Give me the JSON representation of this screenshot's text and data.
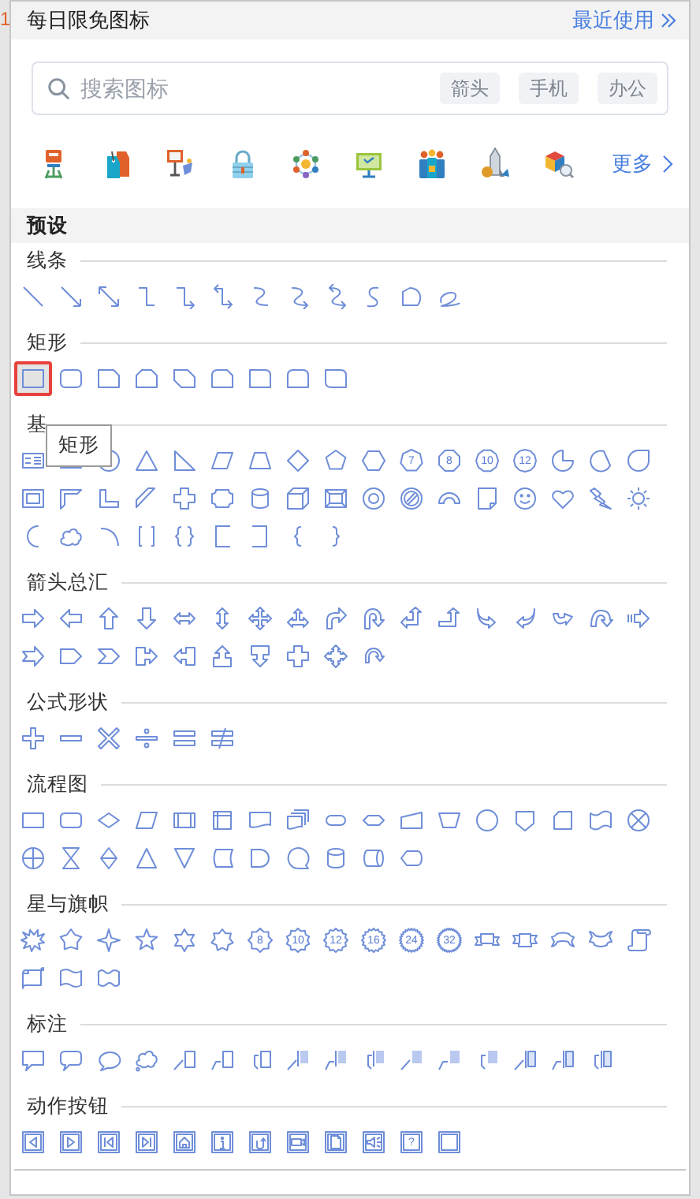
{
  "background": {
    "fragment": "1"
  },
  "free_icons": {
    "title": "每日限免图标",
    "recent_link": "最近使用",
    "search": {
      "placeholder": "搜索图标"
    },
    "tags": [
      "箭头",
      "手机",
      "办公"
    ],
    "more_link": "更多"
  },
  "presets": {
    "title": "预设",
    "tooltip": "矩形",
    "groups": [
      {
        "title": "线条",
        "shapes": [
          {
            "kind": "line",
            "selected": false
          },
          {
            "kind": "arrow",
            "selected": false
          },
          {
            "kind": "double-arrow",
            "selected": false
          },
          {
            "kind": "elbow",
            "selected": false
          },
          {
            "kind": "elbow-arrow",
            "selected": false
          },
          {
            "kind": "elbow-double-arrow",
            "selected": false
          },
          {
            "kind": "curve",
            "selected": false
          },
          {
            "kind": "curve-arrow",
            "selected": false
          },
          {
            "kind": "curve-double-arrow",
            "selected": false
          },
          {
            "kind": "freeform-s",
            "selected": false
          },
          {
            "kind": "freeform",
            "selected": false
          },
          {
            "kind": "scribble",
            "selected": false
          }
        ]
      },
      {
        "title": "矩形",
        "shapes": [
          {
            "kind": "rect",
            "selected": true
          },
          {
            "kind": "round-rect",
            "selected": false
          },
          {
            "kind": "snip1",
            "selected": false
          },
          {
            "kind": "snip2-same",
            "selected": false
          },
          {
            "kind": "snip2-diag",
            "selected": false
          },
          {
            "kind": "snip-round",
            "selected": false
          },
          {
            "kind": "round1",
            "selected": false
          },
          {
            "kind": "round2-same",
            "selected": false
          },
          {
            "kind": "round2-diag",
            "selected": false
          }
        ]
      },
      {
        "title": "基",
        "shapes": [
          {
            "kind": "textbox",
            "selected": false
          },
          {
            "kind": "textbox-v",
            "selected": false
          },
          {
            "kind": "ellipse",
            "selected": false
          },
          {
            "kind": "triangle",
            "selected": false
          },
          {
            "kind": "right-triangle",
            "selected": false
          },
          {
            "kind": "parallelogram",
            "selected": false
          },
          {
            "kind": "trapezoid",
            "selected": false
          },
          {
            "kind": "diamond",
            "selected": false
          },
          {
            "kind": "pentagon",
            "selected": false
          },
          {
            "kind": "hexagon",
            "selected": false
          },
          {
            "kind": "heptagon",
            "label": "7",
            "selected": false
          },
          {
            "kind": "octagon",
            "label": "8",
            "selected": false
          },
          {
            "kind": "decagon",
            "label": "10",
            "selected": false
          },
          {
            "kind": "dodecagon",
            "label": "12",
            "selected": false
          },
          {
            "kind": "pie",
            "selected": false
          },
          {
            "kind": "chord",
            "selected": false
          },
          {
            "kind": "teardrop",
            "selected": false
          },
          {
            "kind": "frame",
            "selected": false
          },
          {
            "kind": "half-frame",
            "selected": false
          },
          {
            "kind": "l-shape",
            "selected": false
          },
          {
            "kind": "diag-stripe",
            "selected": false
          },
          {
            "kind": "cross",
            "selected": false
          },
          {
            "kind": "plaque",
            "selected": false
          },
          {
            "kind": "can",
            "selected": false
          },
          {
            "kind": "cube",
            "selected": false
          },
          {
            "kind": "bevel",
            "selected": false
          },
          {
            "kind": "donut",
            "selected": false
          },
          {
            "kind": "no-symbol",
            "selected": false
          },
          {
            "kind": "block-arc",
            "selected": false
          },
          {
            "kind": "folded-corner",
            "selected": false
          },
          {
            "kind": "smiley",
            "selected": false
          },
          {
            "kind": "heart",
            "selected": false
          },
          {
            "kind": "lightning",
            "selected": false
          },
          {
            "kind": "sun",
            "selected": false
          },
          {
            "kind": "moon",
            "selected": false
          },
          {
            "kind": "cloud",
            "selected": false
          },
          {
            "kind": "arc",
            "selected": false
          },
          {
            "kind": "double-bracket",
            "selected": false
          },
          {
            "kind": "double-brace",
            "selected": false
          },
          {
            "kind": "left-bracket",
            "selected": false
          },
          {
            "kind": "right-bracket",
            "selected": false
          },
          {
            "kind": "left-brace",
            "selected": false
          },
          {
            "kind": "right-brace",
            "selected": false
          }
        ]
      },
      {
        "title": "箭头总汇",
        "shapes": [
          {
            "kind": "right-arrow",
            "selected": false
          },
          {
            "kind": "left-arrow",
            "selected": false
          },
          {
            "kind": "up-arrow",
            "selected": false
          },
          {
            "kind": "down-arrow",
            "selected": false
          },
          {
            "kind": "left-right-arrow",
            "selected": false
          },
          {
            "kind": "up-down-arrow",
            "selected": false
          },
          {
            "kind": "quad-arrow",
            "selected": false
          },
          {
            "kind": "left-right-up-arrow",
            "selected": false
          },
          {
            "kind": "bent-arrow",
            "selected": false
          },
          {
            "kind": "u-turn-arrow",
            "selected": false
          },
          {
            "kind": "left-up-arrow",
            "selected": false
          },
          {
            "kind": "bent-up-arrow",
            "selected": false
          },
          {
            "kind": "curved-right-arrow",
            "selected": false
          },
          {
            "kind": "curved-left-arrow",
            "selected": false
          },
          {
            "kind": "curved-up-arrow",
            "selected": false
          },
          {
            "kind": "curved-down-arrow",
            "selected": false
          },
          {
            "kind": "striped-right-arrow",
            "selected": false
          },
          {
            "kind": "notched-right-arrow",
            "selected": false
          },
          {
            "kind": "pentagon-arrow",
            "selected": false
          },
          {
            "kind": "chevron",
            "selected": false
          },
          {
            "kind": "right-callout-arrow",
            "selected": false
          },
          {
            "kind": "left-callout-arrow",
            "selected": false
          },
          {
            "kind": "up-callout-arrow",
            "selected": false
          },
          {
            "kind": "down-callout-arrow",
            "selected": false
          },
          {
            "kind": "plus-callout-arrow",
            "selected": false
          },
          {
            "kind": "quad-callout-arrow",
            "selected": false
          },
          {
            "kind": "circular-arrow",
            "selected": false
          }
        ]
      },
      {
        "title": "公式形状",
        "shapes": [
          {
            "kind": "plus",
            "selected": false
          },
          {
            "kind": "minus",
            "selected": false
          },
          {
            "kind": "multiply",
            "selected": false
          },
          {
            "kind": "divide",
            "selected": false
          },
          {
            "kind": "equal",
            "selected": false
          },
          {
            "kind": "not-equal",
            "selected": false
          }
        ]
      },
      {
        "title": "流程图",
        "shapes": [
          {
            "kind": "process",
            "selected": false
          },
          {
            "kind": "alt-process",
            "selected": false
          },
          {
            "kind": "decision",
            "selected": false
          },
          {
            "kind": "data",
            "selected": false
          },
          {
            "kind": "predefined",
            "selected": false
          },
          {
            "kind": "internal-storage",
            "selected": false
          },
          {
            "kind": "document",
            "selected": false
          },
          {
            "kind": "multi-document",
            "selected": false
          },
          {
            "kind": "terminator",
            "selected": false
          },
          {
            "kind": "preparation",
            "selected": false
          },
          {
            "kind": "manual-input",
            "selected": false
          },
          {
            "kind": "manual-operation",
            "selected": false
          },
          {
            "kind": "connector",
            "selected": false
          },
          {
            "kind": "offpage",
            "selected": false
          },
          {
            "kind": "card",
            "selected": false
          },
          {
            "kind": "punched-tape",
            "selected": false
          },
          {
            "kind": "summing-junction",
            "selected": false
          },
          {
            "kind": "or",
            "selected": false
          },
          {
            "kind": "collate",
            "selected": false
          },
          {
            "kind": "sort",
            "selected": false
          },
          {
            "kind": "extract",
            "selected": false
          },
          {
            "kind": "merge",
            "selected": false
          },
          {
            "kind": "stored-data",
            "selected": false
          },
          {
            "kind": "delay",
            "selected": false
          },
          {
            "kind": "sequential-access",
            "selected": false
          },
          {
            "kind": "magnetic-disk",
            "selected": false
          },
          {
            "kind": "direct-access",
            "selected": false
          },
          {
            "kind": "display",
            "selected": false
          }
        ]
      },
      {
        "title": "星与旗帜",
        "shapes": [
          {
            "kind": "explosion",
            "selected": false
          },
          {
            "kind": "explosion2",
            "selected": false
          },
          {
            "kind": "star4",
            "selected": false
          },
          {
            "kind": "star5",
            "selected": false
          },
          {
            "kind": "star6",
            "selected": false
          },
          {
            "kind": "star7",
            "selected": false
          },
          {
            "kind": "star8",
            "label": "8",
            "selected": false
          },
          {
            "kind": "star10",
            "label": "10",
            "selected": false
          },
          {
            "kind": "star12",
            "label": "12",
            "selected": false
          },
          {
            "kind": "star16",
            "label": "16",
            "selected": false
          },
          {
            "kind": "star24",
            "label": "24",
            "selected": false
          },
          {
            "kind": "star32",
            "label": "32",
            "selected": false
          },
          {
            "kind": "ribbon-down",
            "selected": false
          },
          {
            "kind": "ribbon-up",
            "selected": false
          },
          {
            "kind": "curved-ribbon-down",
            "selected": false
          },
          {
            "kind": "curved-ribbon-up",
            "selected": false
          },
          {
            "kind": "vertical-scroll",
            "selected": false
          },
          {
            "kind": "horizontal-scroll",
            "selected": false
          },
          {
            "kind": "wave",
            "selected": false
          },
          {
            "kind": "double-wave",
            "selected": false
          }
        ]
      },
      {
        "title": "标注",
        "shapes": [
          {
            "kind": "rect-callout",
            "selected": false
          },
          {
            "kind": "roundrect-callout",
            "selected": false
          },
          {
            "kind": "oval-callout",
            "selected": false
          },
          {
            "kind": "cloud-callout",
            "selected": false
          },
          {
            "kind": "line-callout-1",
            "selected": false
          },
          {
            "kind": "line-callout-2",
            "selected": false
          },
          {
            "kind": "line-callout-3",
            "selected": false
          },
          {
            "kind": "accent-callout-1",
            "selected": false
          },
          {
            "kind": "accent-callout-2",
            "selected": false
          },
          {
            "kind": "accent-callout-3",
            "selected": false
          },
          {
            "kind": "fill-callout-1",
            "selected": false
          },
          {
            "kind": "fill-callout-2",
            "selected": false
          },
          {
            "kind": "fill-callout-3",
            "selected": false
          },
          {
            "kind": "border-accent-callout-1",
            "selected": false
          },
          {
            "kind": "border-accent-callout-2",
            "selected": false
          },
          {
            "kind": "border-accent-callout-3",
            "selected": false
          }
        ]
      },
      {
        "title": "动作按钮",
        "shapes": [
          {
            "kind": "action-back",
            "selected": false
          },
          {
            "kind": "action-forward",
            "selected": false
          },
          {
            "kind": "action-beginning",
            "selected": false
          },
          {
            "kind": "action-end",
            "selected": false
          },
          {
            "kind": "action-home",
            "selected": false
          },
          {
            "kind": "action-info",
            "selected": false
          },
          {
            "kind": "action-return",
            "selected": false
          },
          {
            "kind": "action-movie",
            "selected": false
          },
          {
            "kind": "action-document",
            "selected": false
          },
          {
            "kind": "action-sound",
            "selected": false
          },
          {
            "kind": "action-help",
            "label": "?",
            "selected": false
          },
          {
            "kind": "action-blank",
            "selected": false
          }
        ]
      }
    ]
  }
}
